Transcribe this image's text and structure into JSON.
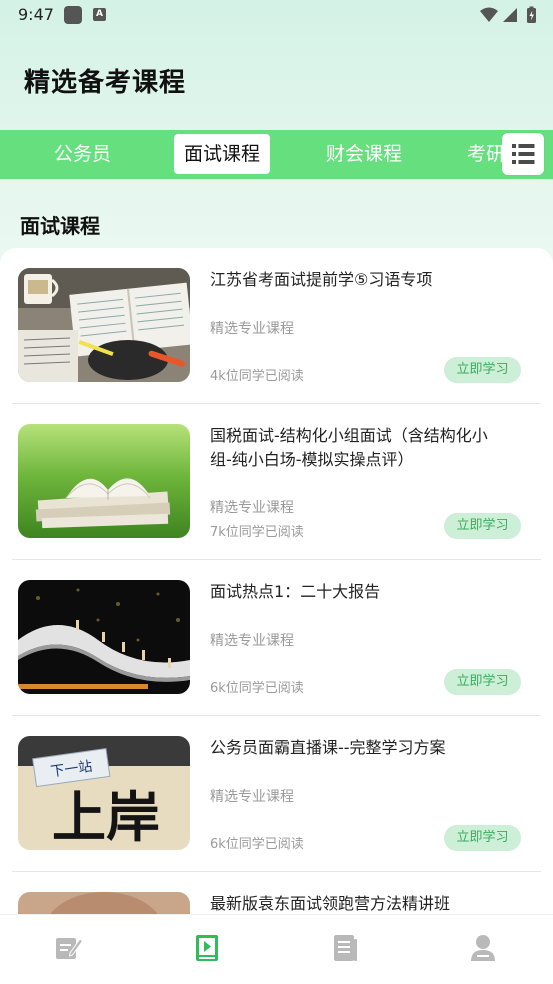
{
  "status_bar": {
    "time": "9:47",
    "notification_icon_letter": "A"
  },
  "page": {
    "title": "精选备考课程",
    "section_heading": "面试课程"
  },
  "tabs": [
    {
      "label": "公务员",
      "active": false
    },
    {
      "label": "面试课程",
      "active": true
    },
    {
      "label": "财会课程",
      "active": false
    },
    {
      "label": "考研课程",
      "active": false
    }
  ],
  "tab_menu_icon": "list-menu-icon",
  "courses": [
    {
      "title": "江苏省考面试提前学⑤习语专项",
      "subtitle": "精选专业课程",
      "reads": "4k位同学已阅读",
      "button": "立即学习",
      "image": "open-notebooks-on-desk"
    },
    {
      "title": "国税面试-结构化小组面试（含结构化小组-纯小白场-模拟实操点评）",
      "subtitle": "精选专业课程",
      "reads": "7k位同学已阅读",
      "button": "立即学习",
      "image": "books-on-grass"
    },
    {
      "title": "面试热点1：二十大报告",
      "subtitle": "精选专业课程",
      "reads": "6k位同学已阅读",
      "button": "立即学习",
      "image": "figures-walking-on-book"
    },
    {
      "title": "公务员面霸直播课--完整学习方案",
      "subtitle": "精选专业课程",
      "reads": "6k位同学已阅读",
      "button": "立即学习",
      "image": "calligraphy-shang-an"
    },
    {
      "title": "最新版袁东面试领跑营方法精讲班",
      "subtitle": "",
      "reads": "",
      "button": "",
      "image": "portrait-partial"
    }
  ],
  "thumb_text": {
    "sign": "下一站",
    "calligraphy": "上岸"
  },
  "bottom_nav": [
    {
      "icon": "edit-notes-icon",
      "active": false
    },
    {
      "icon": "video-play-icon",
      "active": true
    },
    {
      "icon": "article-icon",
      "active": false
    },
    {
      "icon": "user-icon",
      "active": false
    }
  ],
  "colors": {
    "tab_bar": "#66e07e",
    "nav_active": "#2fbd5c",
    "nav_inactive": "#b9b9b9",
    "study_button_bg": "#cdeed7",
    "study_button_text": "#3cac5d"
  }
}
